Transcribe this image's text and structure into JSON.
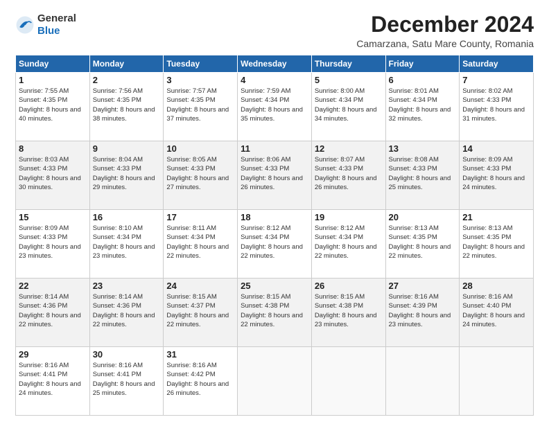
{
  "header": {
    "logo_general": "General",
    "logo_blue": "Blue",
    "main_title": "December 2024",
    "subtitle": "Camarzana, Satu Mare County, Romania"
  },
  "days_of_week": [
    "Sunday",
    "Monday",
    "Tuesday",
    "Wednesday",
    "Thursday",
    "Friday",
    "Saturday"
  ],
  "weeks": [
    [
      {
        "day": 1,
        "sunrise": "7:55 AM",
        "sunset": "4:35 PM",
        "daylight": "8 hours and 40 minutes."
      },
      {
        "day": 2,
        "sunrise": "7:56 AM",
        "sunset": "4:35 PM",
        "daylight": "8 hours and 38 minutes."
      },
      {
        "day": 3,
        "sunrise": "7:57 AM",
        "sunset": "4:35 PM",
        "daylight": "8 hours and 37 minutes."
      },
      {
        "day": 4,
        "sunrise": "7:59 AM",
        "sunset": "4:34 PM",
        "daylight": "8 hours and 35 minutes."
      },
      {
        "day": 5,
        "sunrise": "8:00 AM",
        "sunset": "4:34 PM",
        "daylight": "8 hours and 34 minutes."
      },
      {
        "day": 6,
        "sunrise": "8:01 AM",
        "sunset": "4:34 PM",
        "daylight": "8 hours and 32 minutes."
      },
      {
        "day": 7,
        "sunrise": "8:02 AM",
        "sunset": "4:33 PM",
        "daylight": "8 hours and 31 minutes."
      }
    ],
    [
      {
        "day": 8,
        "sunrise": "8:03 AM",
        "sunset": "4:33 PM",
        "daylight": "8 hours and 30 minutes."
      },
      {
        "day": 9,
        "sunrise": "8:04 AM",
        "sunset": "4:33 PM",
        "daylight": "8 hours and 29 minutes."
      },
      {
        "day": 10,
        "sunrise": "8:05 AM",
        "sunset": "4:33 PM",
        "daylight": "8 hours and 27 minutes."
      },
      {
        "day": 11,
        "sunrise": "8:06 AM",
        "sunset": "4:33 PM",
        "daylight": "8 hours and 26 minutes."
      },
      {
        "day": 12,
        "sunrise": "8:07 AM",
        "sunset": "4:33 PM",
        "daylight": "8 hours and 26 minutes."
      },
      {
        "day": 13,
        "sunrise": "8:08 AM",
        "sunset": "4:33 PM",
        "daylight": "8 hours and 25 minutes."
      },
      {
        "day": 14,
        "sunrise": "8:09 AM",
        "sunset": "4:33 PM",
        "daylight": "8 hours and 24 minutes."
      }
    ],
    [
      {
        "day": 15,
        "sunrise": "8:09 AM",
        "sunset": "4:33 PM",
        "daylight": "8 hours and 23 minutes."
      },
      {
        "day": 16,
        "sunrise": "8:10 AM",
        "sunset": "4:34 PM",
        "daylight": "8 hours and 23 minutes."
      },
      {
        "day": 17,
        "sunrise": "8:11 AM",
        "sunset": "4:34 PM",
        "daylight": "8 hours and 22 minutes."
      },
      {
        "day": 18,
        "sunrise": "8:12 AM",
        "sunset": "4:34 PM",
        "daylight": "8 hours and 22 minutes."
      },
      {
        "day": 19,
        "sunrise": "8:12 AM",
        "sunset": "4:34 PM",
        "daylight": "8 hours and 22 minutes."
      },
      {
        "day": 20,
        "sunrise": "8:13 AM",
        "sunset": "4:35 PM",
        "daylight": "8 hours and 22 minutes."
      },
      {
        "day": 21,
        "sunrise": "8:13 AM",
        "sunset": "4:35 PM",
        "daylight": "8 hours and 22 minutes."
      }
    ],
    [
      {
        "day": 22,
        "sunrise": "8:14 AM",
        "sunset": "4:36 PM",
        "daylight": "8 hours and 22 minutes."
      },
      {
        "day": 23,
        "sunrise": "8:14 AM",
        "sunset": "4:36 PM",
        "daylight": "8 hours and 22 minutes."
      },
      {
        "day": 24,
        "sunrise": "8:15 AM",
        "sunset": "4:37 PM",
        "daylight": "8 hours and 22 minutes."
      },
      {
        "day": 25,
        "sunrise": "8:15 AM",
        "sunset": "4:38 PM",
        "daylight": "8 hours and 22 minutes."
      },
      {
        "day": 26,
        "sunrise": "8:15 AM",
        "sunset": "4:38 PM",
        "daylight": "8 hours and 23 minutes."
      },
      {
        "day": 27,
        "sunrise": "8:16 AM",
        "sunset": "4:39 PM",
        "daylight": "8 hours and 23 minutes."
      },
      {
        "day": 28,
        "sunrise": "8:16 AM",
        "sunset": "4:40 PM",
        "daylight": "8 hours and 24 minutes."
      }
    ],
    [
      {
        "day": 29,
        "sunrise": "8:16 AM",
        "sunset": "4:41 PM",
        "daylight": "8 hours and 24 minutes."
      },
      {
        "day": 30,
        "sunrise": "8:16 AM",
        "sunset": "4:41 PM",
        "daylight": "8 hours and 25 minutes."
      },
      {
        "day": 31,
        "sunrise": "8:16 AM",
        "sunset": "4:42 PM",
        "daylight": "8 hours and 26 minutes."
      },
      null,
      null,
      null,
      null
    ]
  ]
}
